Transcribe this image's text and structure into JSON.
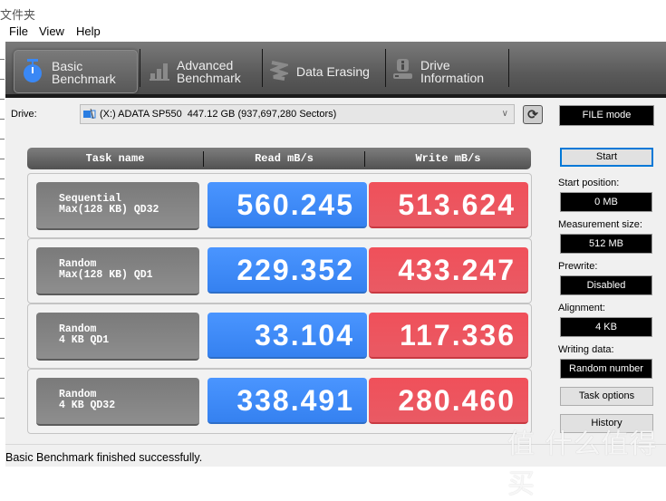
{
  "window": {
    "folder_title": "文件夹"
  },
  "menu": {
    "items": [
      "File",
      "View",
      "Help"
    ]
  },
  "tabs": [
    {
      "label_line1": "Basic",
      "label_line2": "Benchmark",
      "icon": "stopwatch-icon",
      "active": true
    },
    {
      "label_line1": "Advanced",
      "label_line2": "Benchmark",
      "icon": "bar-chart-icon",
      "active": false
    },
    {
      "label_line1": "Data Erasing",
      "label_line2": "",
      "icon": "eraser-spring-icon",
      "active": false
    },
    {
      "label_line1": "Drive",
      "label_line2": "Information",
      "icon": "drive-info-icon",
      "active": false
    }
  ],
  "drive": {
    "label": "Drive:",
    "selected": "(X:) ADATA SP550  447.12 GB (937,697,280 Sectors)",
    "icon": "drive-icon",
    "refresh_icon": "refresh-icon"
  },
  "mode": "FILE mode",
  "table": {
    "headers": [
      "Task name",
      "Read mB/s",
      "Write mB/s"
    ],
    "rows": [
      {
        "task_line1": "Sequential",
        "task_line2": "Max(128 KB) QD32",
        "read": "560.245",
        "write": "513.624"
      },
      {
        "task_line1": "Random",
        "task_line2": "Max(128 KB) QD1",
        "read": "229.352",
        "write": "433.247"
      },
      {
        "task_line1": "Random",
        "task_line2": "4 KB QD1",
        "read": "33.104",
        "write": "117.336"
      },
      {
        "task_line1": "Random",
        "task_line2": "4 KB QD32",
        "read": "338.491",
        "write": "280.460"
      }
    ]
  },
  "side": {
    "start_label": "Start",
    "start_position_label": "Start position:",
    "start_position": "0 MB",
    "measurement_size_label": "Measurement size:",
    "measurement_size": "512 MB",
    "prewrite_label": "Prewrite:",
    "prewrite": "Disabled",
    "alignment_label": "Alignment:",
    "alignment": "4 KB",
    "writing_data_label": "Writing data:",
    "writing_data": "Random number",
    "task_options_label": "Task options",
    "history_label": "History"
  },
  "status": "Basic Benchmark finished successfully.",
  "watermark": "值 什么值得买",
  "colors": {
    "read": "#3d8bf8",
    "write": "#ec5660",
    "tabbar": "#5a5a5a",
    "task": "#808080"
  }
}
